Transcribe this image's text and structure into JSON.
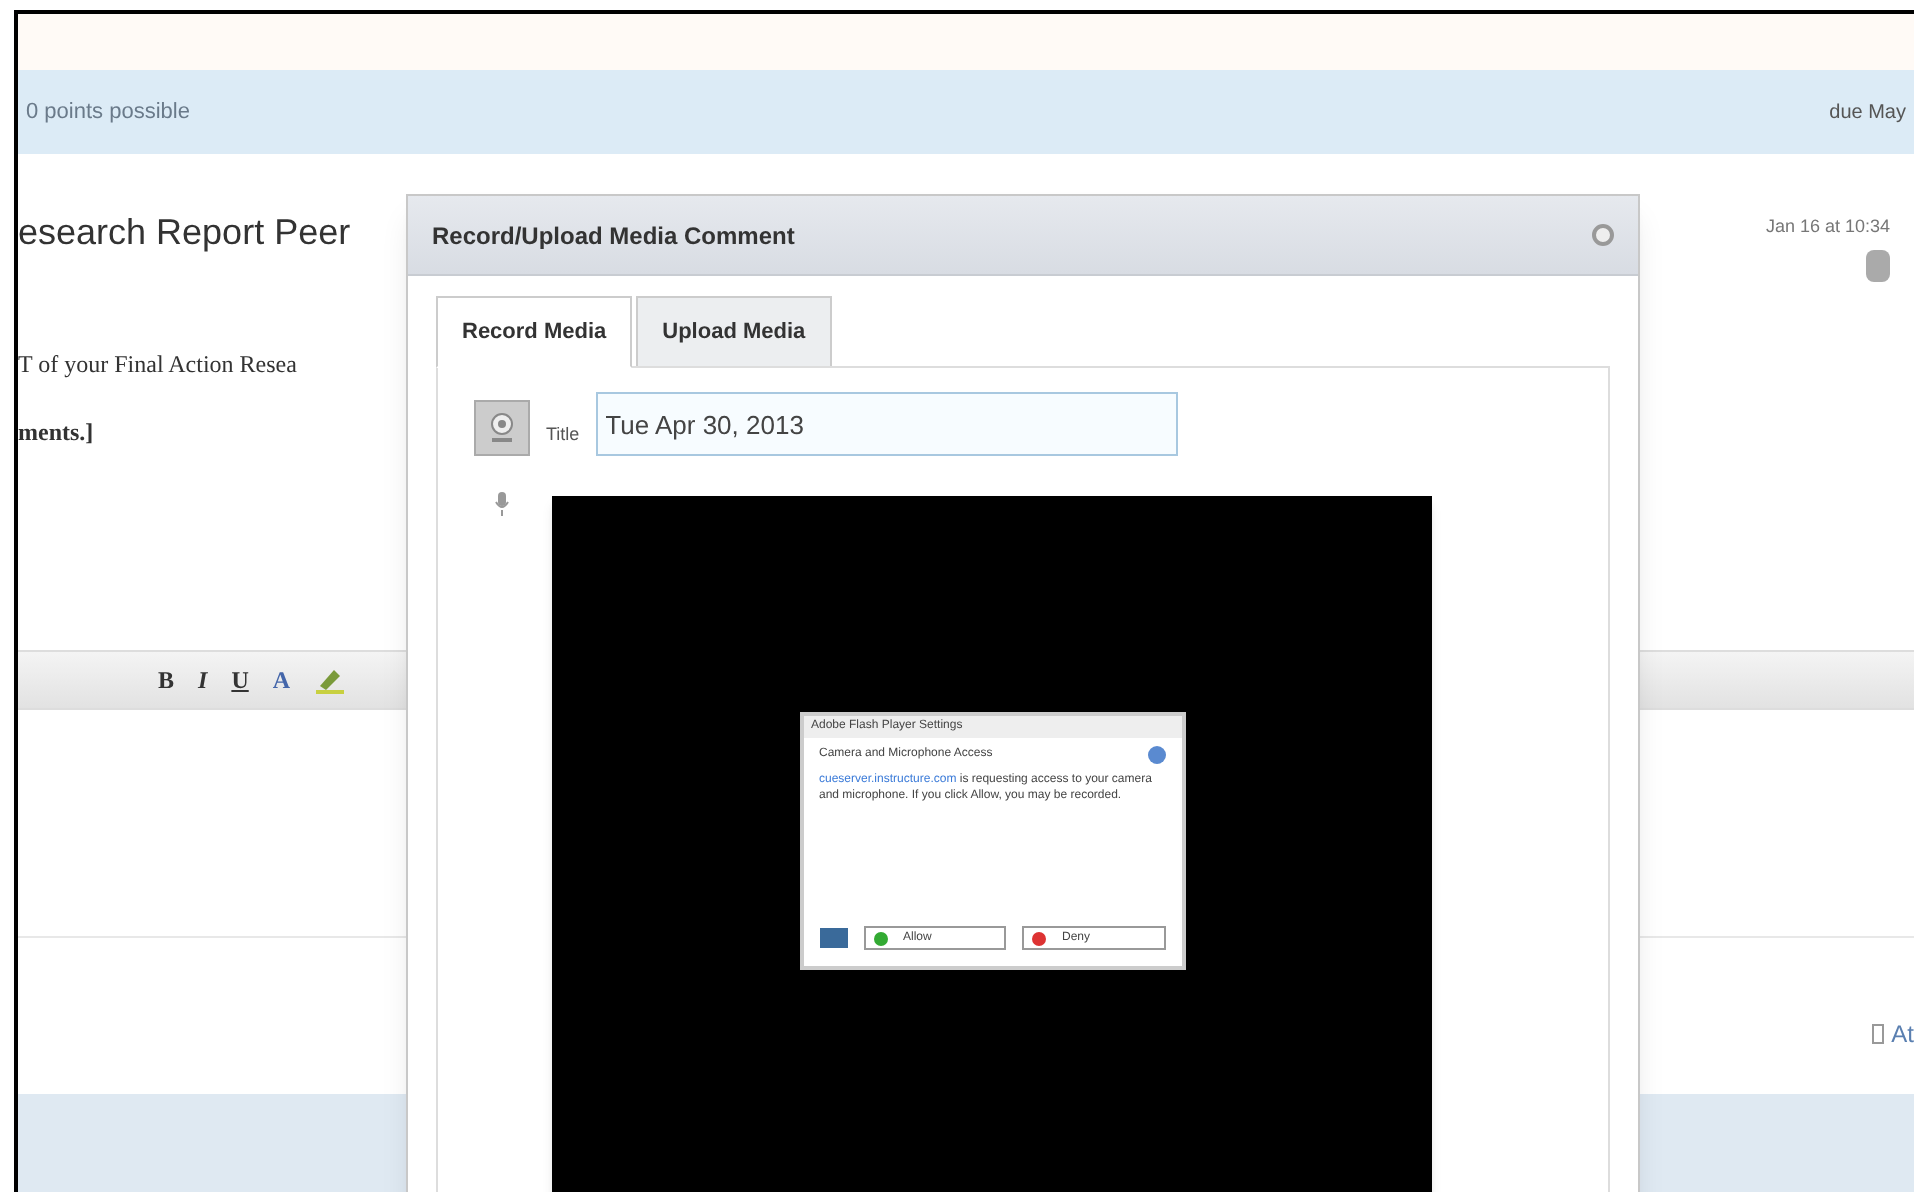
{
  "assignment_bar": {
    "points": "0 points possible",
    "due": "due May"
  },
  "heading": "esearch Report Peer",
  "timestamp": "Jan 16 at 10:34",
  "body": [
    {
      "text": "T of your Final Action Resea",
      "bold": false
    },
    {
      "text": "ments.]",
      "bold": true
    }
  ],
  "toolbar": [
    "B",
    "I",
    "U",
    "A"
  ],
  "attach_label": "At",
  "modal": {
    "title": "Record/Upload Media Comment",
    "tabs": [
      {
        "label": "Record Media",
        "selected": true
      },
      {
        "label": "Upload Media",
        "selected": false
      }
    ],
    "title_label": "Title",
    "title_value": "Tue Apr 30, 2013",
    "flash": {
      "title": "Adobe Flash Player Settings",
      "heading": "Camera and Microphone Access",
      "link": "cueserver.instructure.com",
      "message": "is requesting access to your camera and microphone. If you click Allow, you may be recorded.",
      "allow": "Allow",
      "deny": "Deny"
    }
  }
}
